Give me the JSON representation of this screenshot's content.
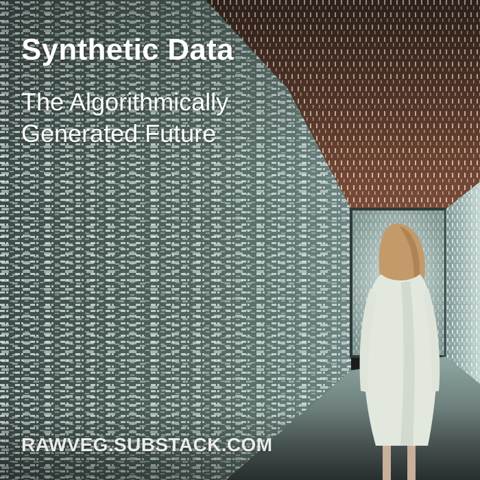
{
  "cover": {
    "title": "Synthetic Data",
    "subtitle_line1": "The Algorithmically",
    "subtitle_line2": "Generated Future",
    "footer": "RAWVEG.SUBSTACK.COM"
  },
  "colors": {
    "wall_glow": "#a9c7c2",
    "ceiling": "#6b4232",
    "floor": "#5e6e6c",
    "text": "#ffffff"
  }
}
